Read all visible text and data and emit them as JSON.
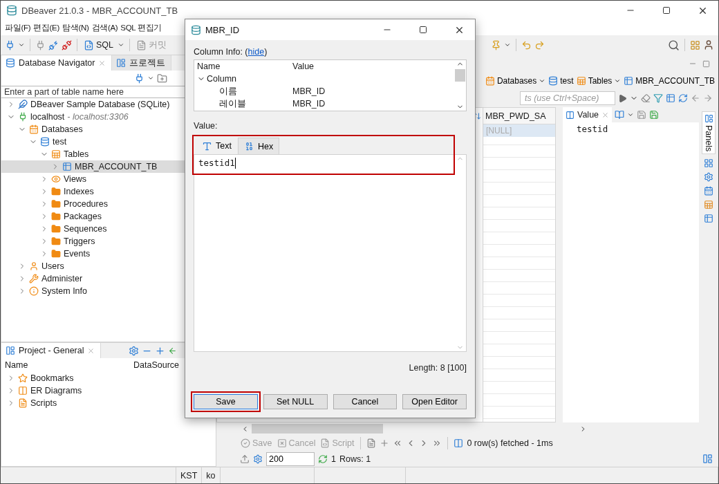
{
  "window": {
    "title": "DBeaver 21.0.3 - MBR_ACCOUNT_TB"
  },
  "menu": [
    "파일(F)",
    "편집(E)",
    "탐색(N)",
    "검색(A)",
    "SQL 편집기"
  ],
  "toolbar": {
    "sql_label": "SQL",
    "commit_label": "커밋"
  },
  "navigator": {
    "tabs": [
      {
        "label": "Database Navigator",
        "selected": true
      },
      {
        "label": "프로젝트",
        "selected": false
      }
    ],
    "search": {
      "placeholder": "Enter a part of table name here"
    },
    "tree": [
      {
        "label": "DBeaver Sample Database (SQLite)",
        "kind": "sqlite",
        "expanded": false,
        "selected": false
      },
      {
        "label": "localhost",
        "detail": " - localhost:3306",
        "kind": "connection",
        "expanded": true,
        "selected": false,
        "children": [
          {
            "label": "Databases",
            "kind": "databases",
            "expanded": true,
            "selected": false,
            "children": [
              {
                "label": "test",
                "kind": "database",
                "expanded": true,
                "selected": false,
                "children": [
                  {
                    "label": "Tables",
                    "kind": "tables",
                    "expanded": true,
                    "selected": false,
                    "children": [
                      {
                        "label": "MBR_ACCOUNT_TB",
                        "kind": "table",
                        "expanded": false,
                        "selected": true
                      }
                    ]
                  },
                  {
                    "label": "Views",
                    "kind": "views",
                    "expanded": false,
                    "selected": false
                  },
                  {
                    "label": "Indexes",
                    "kind": "folder",
                    "expanded": false,
                    "selected": false
                  },
                  {
                    "label": "Procedures",
                    "kind": "folder",
                    "expanded": false,
                    "selected": false
                  },
                  {
                    "label": "Packages",
                    "kind": "folder",
                    "expanded": false,
                    "selected": false
                  },
                  {
                    "label": "Sequences",
                    "kind": "folder",
                    "expanded": false,
                    "selected": false
                  },
                  {
                    "label": "Triggers",
                    "kind": "folder",
                    "expanded": false,
                    "selected": false
                  },
                  {
                    "label": "Events",
                    "kind": "folder",
                    "expanded": false,
                    "selected": false
                  }
                ]
              }
            ]
          },
          {
            "label": "Users",
            "kind": "users",
            "expanded": false,
            "selected": false
          },
          {
            "label": "Administer",
            "kind": "administer",
            "expanded": false,
            "selected": false
          },
          {
            "label": "System Info",
            "kind": "info",
            "expanded": false,
            "selected": false
          }
        ]
      }
    ]
  },
  "project": {
    "title": "Project - General",
    "columns": [
      "Name",
      "DataSource"
    ],
    "items": [
      {
        "label": "Bookmarks",
        "kind": "bookmarks"
      },
      {
        "label": "ER Diagrams",
        "kind": "diagrams"
      },
      {
        "label": "Scripts",
        "kind": "scripts"
      }
    ]
  },
  "editor": {
    "breadcrumb": [
      {
        "label": "Databases",
        "kind": "databases",
        "dropdown": true
      },
      {
        "label": "test",
        "kind": "database",
        "dropdown": false
      },
      {
        "label": "Tables",
        "kind": "tables",
        "dropdown": true
      },
      {
        "label": "MBR_ACCOUNT_TB",
        "kind": "table",
        "dropdown": false
      }
    ],
    "filter": {
      "placeholder": "ts (use Ctrl+Space)"
    },
    "grid": {
      "column": "MBR_PWD_SA",
      "rows": [
        {
          "value": "[NULL]",
          "selected": true
        }
      ]
    },
    "value_panel": {
      "title": "Value",
      "content": "testid"
    },
    "panels_label": "Panels",
    "results": {
      "actions": [
        {
          "label": "Save",
          "kind": "save",
          "disabled": true
        },
        {
          "label": "Cancel",
          "kind": "cancel",
          "disabled": true
        },
        {
          "label": "Script",
          "kind": "script",
          "disabled": true
        }
      ],
      "status": "0 row(s) fetched - 1ms",
      "fetch_size": "200",
      "count": "1",
      "rows": "Rows: 1"
    }
  },
  "status_bar": [
    "KST",
    "ko"
  ],
  "dialog": {
    "title": "MBR_ID",
    "info_prefix": "Column Info: (",
    "hide_link": "hide",
    "info_suffix": ")",
    "columns": [
      "Name",
      "Value"
    ],
    "info": [
      {
        "name": "Column",
        "expanded": true,
        "children": [
          {
            "name": "이름",
            "value": "MBR_ID"
          },
          {
            "name": "레이블",
            "value": "MBR_ID"
          }
        ]
      }
    ],
    "value_label": "Value:",
    "tabs": [
      {
        "label": "Text",
        "kind": "text",
        "selected": true
      },
      {
        "label": "Hex",
        "kind": "hex",
        "selected": false
      }
    ],
    "editor": {
      "value": "testid1",
      "annotated": true
    },
    "length": "Length: 8 [100]",
    "buttons": [
      {
        "label": "Save",
        "annotated": true
      },
      {
        "label": "Set NULL",
        "annotated": false
      },
      {
        "label": "Cancel",
        "annotated": false
      },
      {
        "label": "Open Editor",
        "annotated": false
      }
    ]
  }
}
